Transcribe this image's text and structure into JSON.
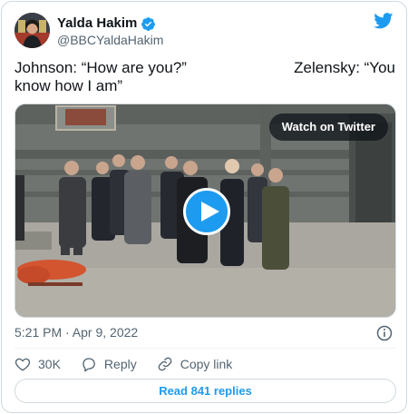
{
  "author": {
    "display_name": "Yalda Hakim",
    "handle": "@BBCYaldaHakim",
    "verified": true,
    "avatar_icon": "avatar-photo-icon"
  },
  "tweet": {
    "line1_left": "Johnson: “How are you?”",
    "line1_right": "Zelensky: “You",
    "line2": "know how I am”"
  },
  "media": {
    "watch_label": "Watch on Twitter",
    "play_icon": "play-icon"
  },
  "meta": {
    "timestamp": "5:21 PM · Apr 9, 2022"
  },
  "actions": {
    "likes": "30K",
    "reply_label": "Reply",
    "copy_label": "Copy link"
  },
  "footer": {
    "read_replies": "Read 841 replies"
  },
  "colors": {
    "accent": "#1d9bf0",
    "secondary_text": "#536471",
    "border": "#cfd9de"
  }
}
